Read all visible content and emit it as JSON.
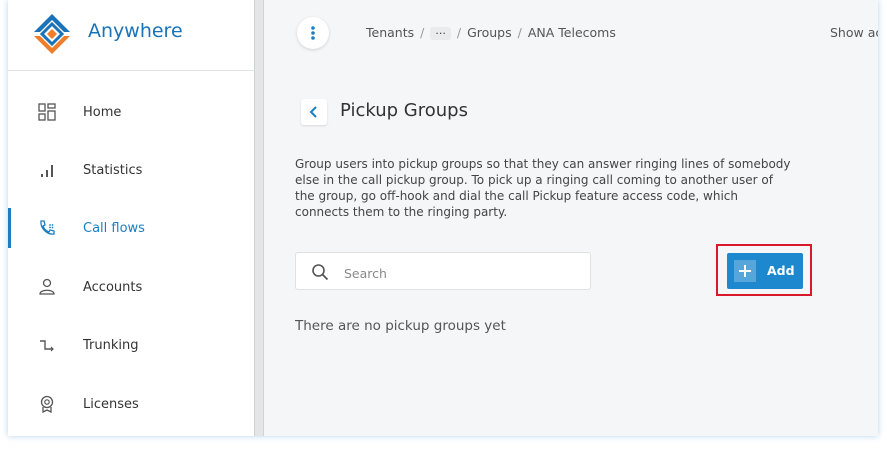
{
  "brand": {
    "name": "Anywhere",
    "colors": {
      "blue": "#1a73b8",
      "orange": "#f07d2a"
    }
  },
  "sidebar": {
    "items": [
      {
        "label": "Home",
        "icon": "home-grid-icon",
        "active": false
      },
      {
        "label": "Statistics",
        "icon": "bar-chart-icon",
        "active": false
      },
      {
        "label": "Call flows",
        "icon": "phone-flow-icon",
        "active": true
      },
      {
        "label": "Accounts",
        "icon": "user-icon",
        "active": false
      },
      {
        "label": "Trunking",
        "icon": "trunk-icon",
        "active": false
      },
      {
        "label": "Licenses",
        "icon": "license-badge-icon",
        "active": false
      }
    ],
    "active_color": "#1a7fc1"
  },
  "header": {
    "menu_icon": "vertical-dots-icon",
    "breadcrumb": [
      "Tenants",
      "···",
      "Groups",
      "ANA Telecoms"
    ],
    "right_text": "Show ac"
  },
  "page": {
    "title": "Pickup Groups",
    "back_icon": "chevron-left-icon",
    "description": "Group users into pickup groups so that they can answer ringing lines of somebody else in the call pickup group. To pick up a ringing call coming to another user of the group, go off-hook and dial the call Pickup feature access code, which connects them to the ringing party.",
    "search": {
      "placeholder": "Search",
      "value": ""
    },
    "add_button": {
      "label": "Add",
      "icon": "plus-icon",
      "color": "#1e88cf",
      "highlight_color": "#d9182c"
    },
    "empty_message": "There are no pickup groups yet"
  }
}
